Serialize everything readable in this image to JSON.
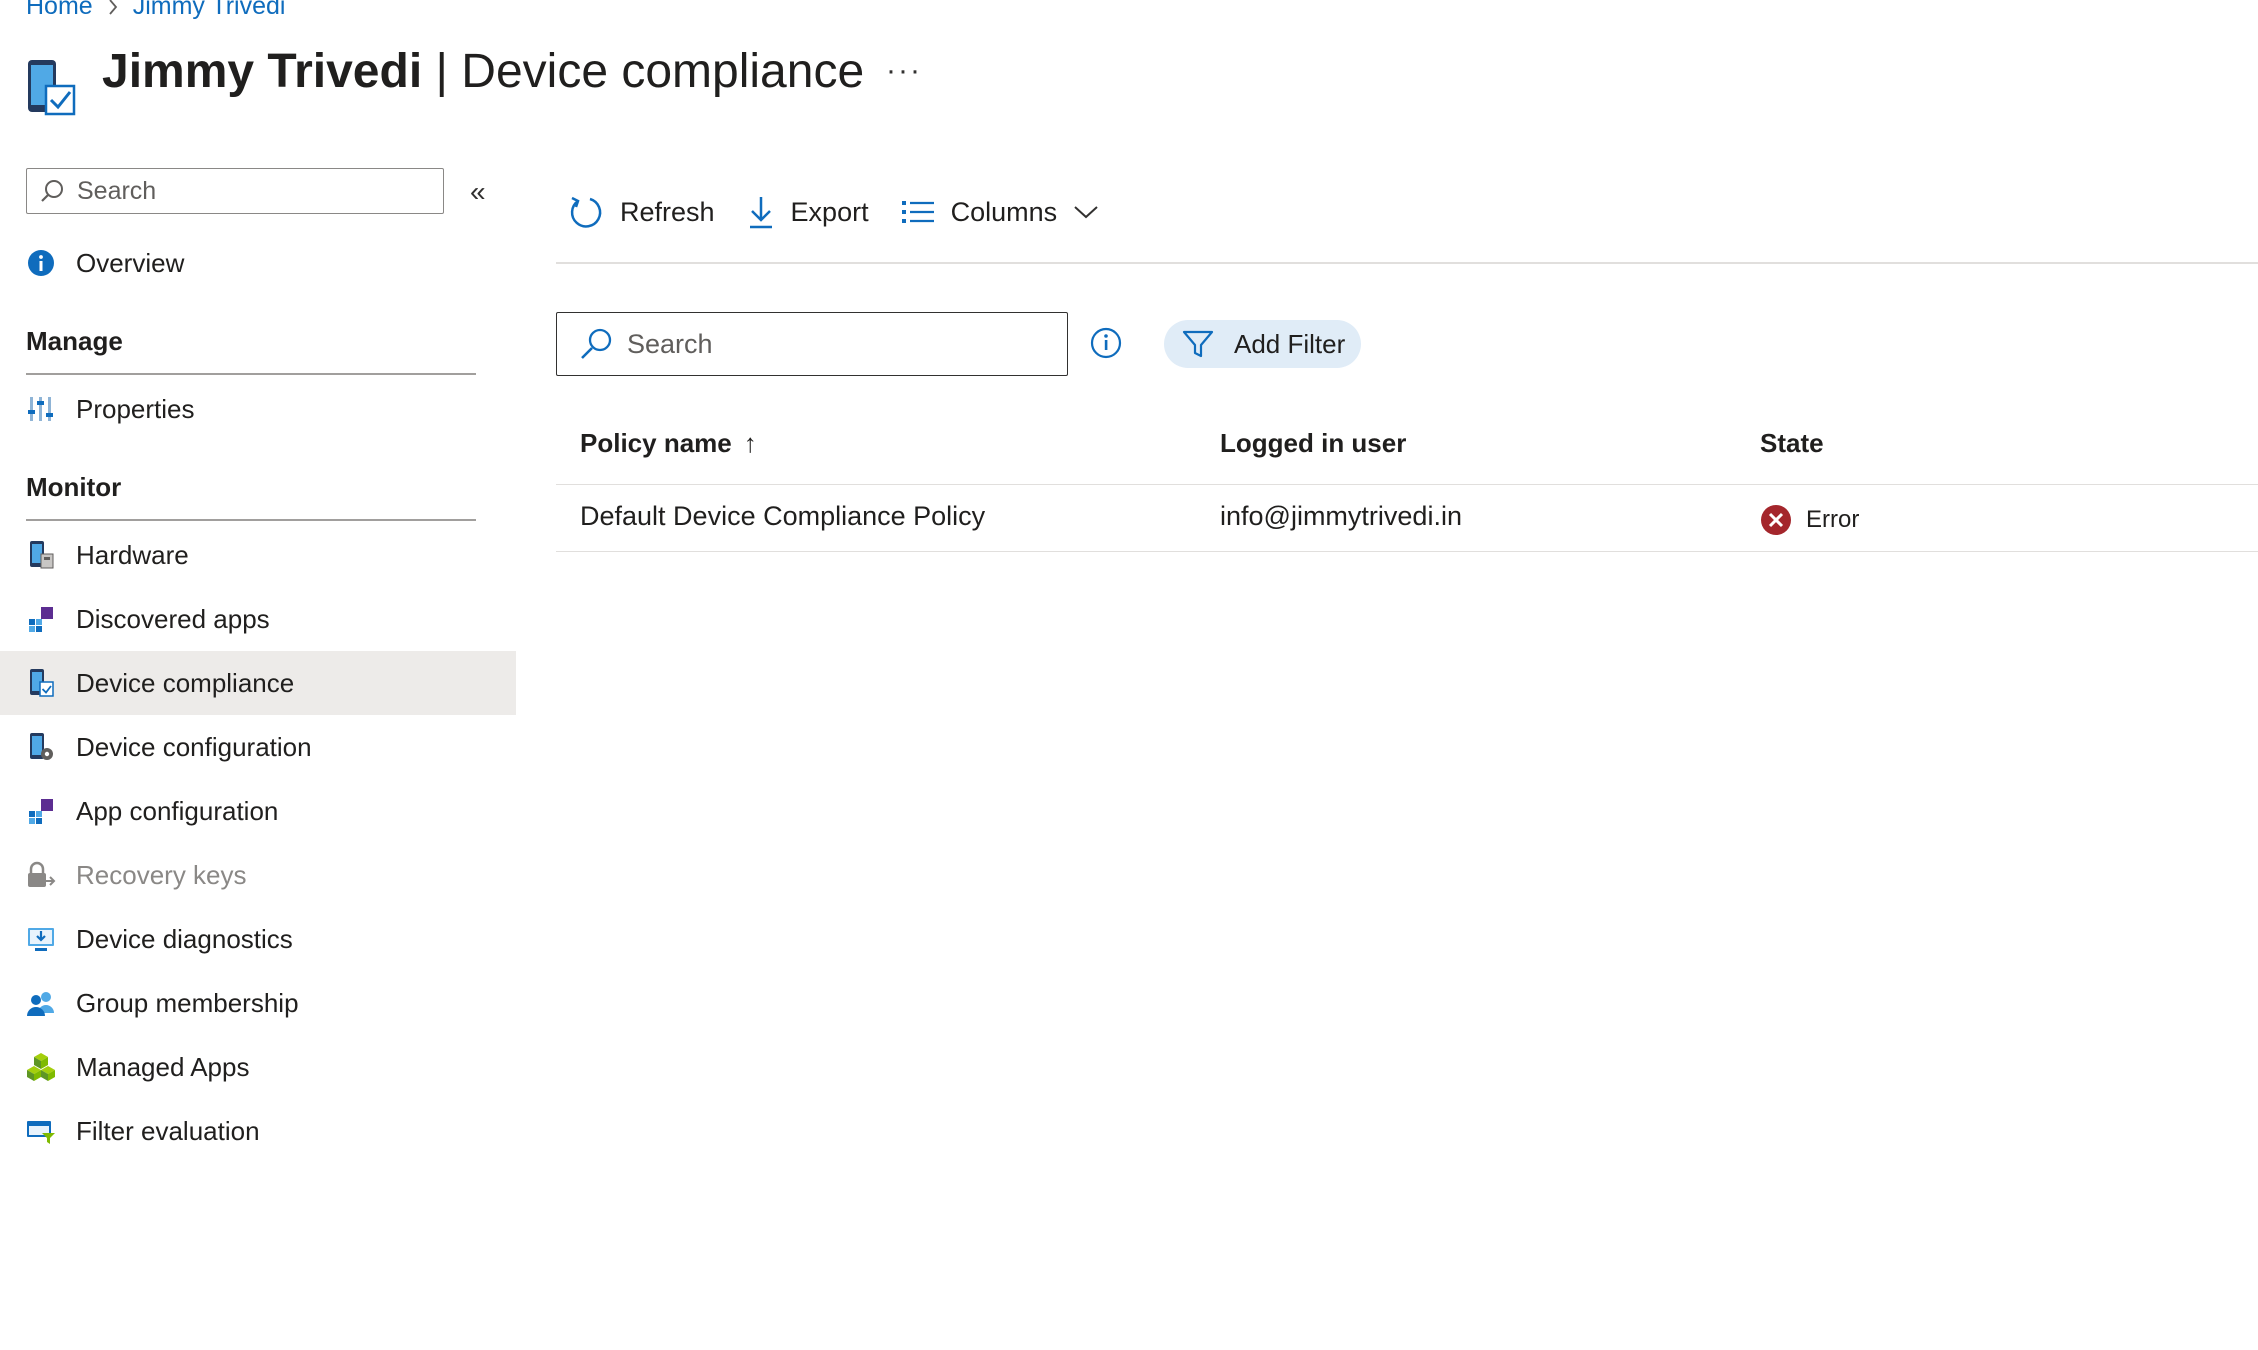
{
  "breadcrumb": [
    "Home",
    "Jimmy Trivedi"
  ],
  "header": {
    "title_strong": "Jimmy Trivedi",
    "title_rest": " | Device compliance",
    "more": "···"
  },
  "sidebar": {
    "search_placeholder": "Search",
    "collapse": "«",
    "overview": "Overview",
    "sections": {
      "manage": "Manage",
      "monitor": "Monitor"
    },
    "manage_items": [
      {
        "label": "Properties",
        "icon": "properties-icon"
      }
    ],
    "monitor_items": [
      {
        "label": "Hardware",
        "icon": "hardware-icon"
      },
      {
        "label": "Discovered apps",
        "icon": "discovered-apps-icon"
      },
      {
        "label": "Device compliance",
        "icon": "device-compliance-icon",
        "selected": true
      },
      {
        "label": "Device configuration",
        "icon": "device-configuration-icon"
      },
      {
        "label": "App configuration",
        "icon": "app-configuration-icon"
      },
      {
        "label": "Recovery keys",
        "icon": "recovery-keys-icon",
        "disabled": true
      },
      {
        "label": "Device diagnostics",
        "icon": "device-diagnostics-icon"
      },
      {
        "label": "Group membership",
        "icon": "group-membership-icon"
      },
      {
        "label": "Managed Apps",
        "icon": "managed-apps-icon"
      },
      {
        "label": "Filter evaluation",
        "icon": "filter-evaluation-icon"
      }
    ]
  },
  "toolbar": {
    "refresh": "Refresh",
    "export": "Export",
    "columns": "Columns"
  },
  "main": {
    "search_placeholder": "Search",
    "add_filter": "Add Filter"
  },
  "table": {
    "columns": {
      "policy_name": "Policy name",
      "logged_in_user": "Logged in user",
      "state": "State"
    },
    "sort_indicator": "↑",
    "rows": [
      {
        "policy_name": "Default Device Compliance Policy",
        "logged_in_user": "info@jimmytrivedi.in",
        "state": "Error"
      }
    ]
  },
  "colors": {
    "accent": "#0f6cbd",
    "selected_bg": "#edebe9",
    "error": "#a4262c",
    "filter_bg": "#e0ecf7"
  }
}
